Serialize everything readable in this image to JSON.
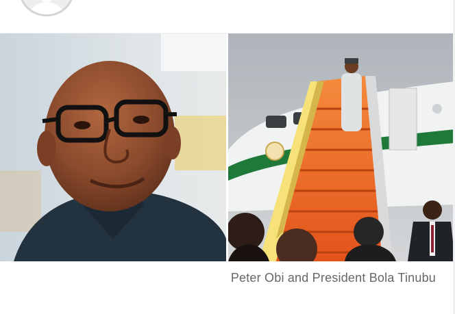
{
  "photo": {
    "caption": "Peter Obi and President Bola Tinubu"
  },
  "colors": {
    "caption_text": "#666666",
    "accent": "#2aa6c9",
    "aircraft_green": "#1f7a3a",
    "stairs_orange": "#f06a24"
  },
  "icons": [
    "avatar-placeholder-icon",
    "share-icon",
    "more-options-icon"
  ]
}
